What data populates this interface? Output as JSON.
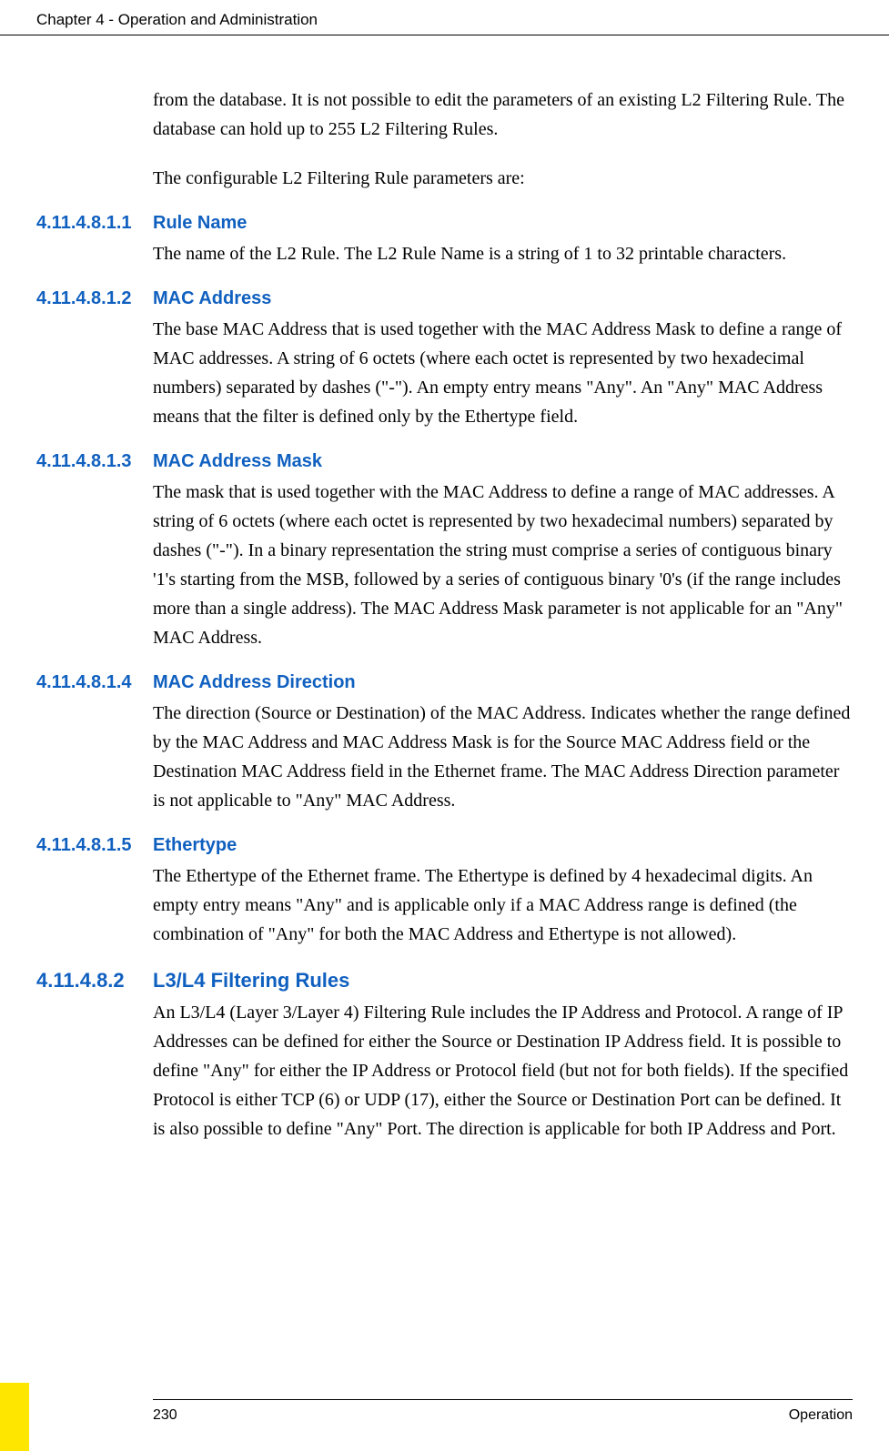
{
  "header": {
    "chapter": "Chapter 4 - Operation and Administration"
  },
  "intro": {
    "p1": "from the database. It is not possible to edit the parameters of an existing L2 Filtering Rule. The database can hold up to 255 L2 Filtering Rules.",
    "p2": "The configurable L2 Filtering Rule parameters are:"
  },
  "sections": {
    "s1": {
      "num": "4.11.4.8.1.1",
      "title": "Rule Name",
      "body": "The name of the L2 Rule. The L2 Rule Name is a string of 1 to 32 printable characters."
    },
    "s2": {
      "num": "4.11.4.8.1.2",
      "title": "MAC Address",
      "body": "The base MAC Address that is used together with the MAC Address Mask to define a range of MAC addresses. A string of 6 octets (where each octet is represented by two hexadecimal numbers) separated by dashes (\"-\"). An empty entry means \"Any\". An \"Any\" MAC Address means that the filter is defined only by the Ethertype field."
    },
    "s3": {
      "num": "4.11.4.8.1.3",
      "title": "MAC Address Mask",
      "body": "The mask that is used together with the MAC Address to define a range of MAC addresses. A string of 6 octets (where each octet is represented by two hexadecimal numbers) separated by dashes (\"-\"). In a binary representation the string must comprise a series of contiguous binary '1's starting from the MSB, followed by a series of contiguous binary '0's (if the range includes more than a single address). The MAC Address Mask parameter is not applicable for an \"Any\" MAC Address."
    },
    "s4": {
      "num": "4.11.4.8.1.4",
      "title": "MAC Address Direction",
      "body": "The direction (Source or Destination) of the MAC Address. Indicates whether the range defined by the MAC Address and MAC Address Mask is for the Source MAC Address field or the Destination MAC Address field in the Ethernet frame. The MAC Address Direction parameter is not applicable to \"Any\" MAC Address."
    },
    "s5": {
      "num": "4.11.4.8.1.5",
      "title": "Ethertype",
      "body": "The Ethertype of the Ethernet frame. The Ethertype is defined by 4 hexadecimal digits. An empty entry means \"Any\" and is applicable only if a MAC Address range is defined (the combination of \"Any\" for both the MAC Address and Ethertype is not allowed)."
    },
    "s6": {
      "num": "4.11.4.8.2",
      "title": "L3/L4 Filtering Rules",
      "body": "An L3/L4 (Layer 3/Layer 4) Filtering Rule includes the IP Address and Protocol. A range of IP Addresses can be defined for either the Source or Destination IP Address field. It is possible to define \"Any\" for either the IP Address or Protocol field (but not for both fields). If the specified Protocol is either TCP (6) or UDP (17), either the Source or Destination Port can be defined. It is also possible to define \"Any\" Port. The direction is applicable for both IP Address and Port."
    }
  },
  "footer": {
    "page": "230",
    "label": "Operation"
  }
}
